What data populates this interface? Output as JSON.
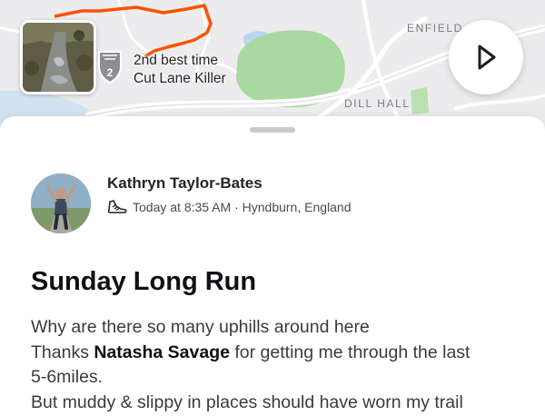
{
  "map": {
    "labels": {
      "enfield": "ENFIELD",
      "dill_hall": "DILL HALL"
    },
    "segment": {
      "rank_number": "2",
      "line1": "2nd best time",
      "line2": "Cut Lane Killer"
    },
    "play_icon": "play-icon",
    "colors": {
      "route": "#fc5200",
      "park": "#9fd89a",
      "water": "#c6dcef",
      "road": "#ffffff"
    }
  },
  "activity": {
    "athlete_name": "Kathryn Taylor-Bates",
    "activity_icon": "running-shoe-icon",
    "timestamp": "Today at 8:35 AM",
    "separator": " · ",
    "location": "Hyndburn, England",
    "title": "Sunday Long Run",
    "description": {
      "line1": "Why are there so many uphills around here",
      "line2_prefix": "Thanks ",
      "mention": "Natasha Savage",
      "line2_suffix": " for getting me through the last",
      "line3": "5-6miles.",
      "line4": "But muddy & slippy in places should have worn my trail"
    }
  }
}
